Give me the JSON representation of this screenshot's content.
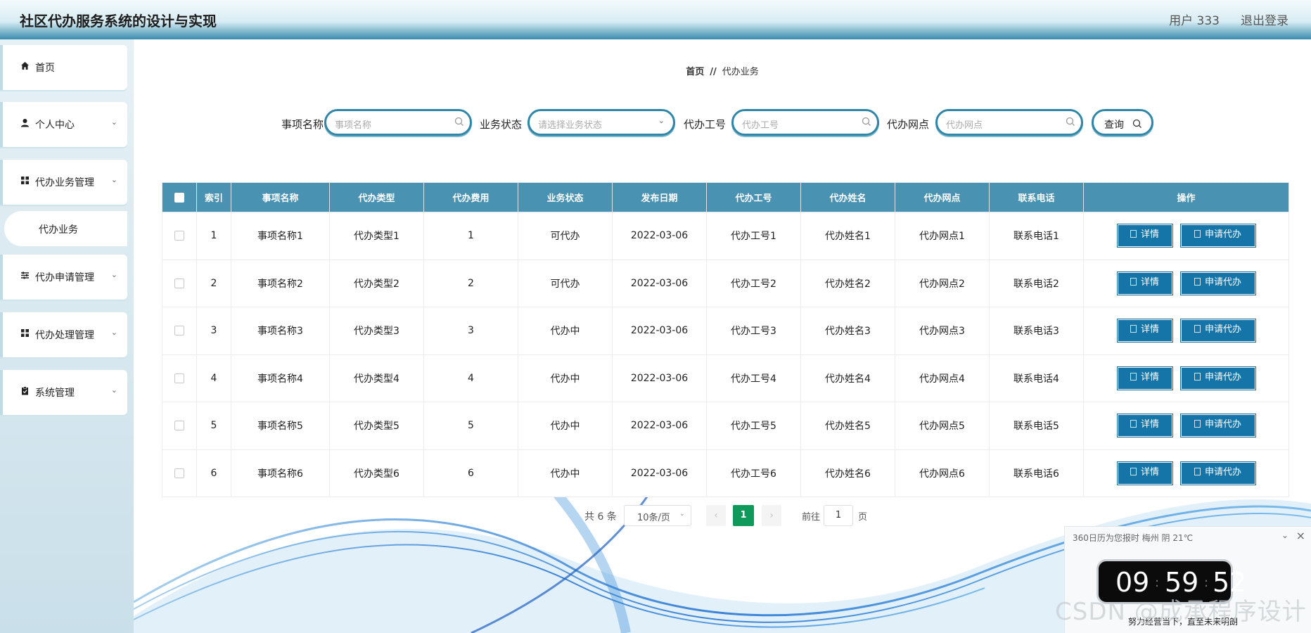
{
  "header": {
    "title": "社区代办服务系统的设计与实现",
    "user": "用户 333",
    "logout": "退出登录"
  },
  "sidebar": {
    "items": [
      {
        "label": "首页",
        "icon": "home-icon"
      },
      {
        "label": "个人中心",
        "icon": "user-icon"
      },
      {
        "label": "代办业务管理",
        "icon": "grid-icon"
      },
      {
        "label": "代办申请管理",
        "icon": "sliders-icon"
      },
      {
        "label": "代办处理管理",
        "icon": "grid-icon"
      },
      {
        "label": "系统管理",
        "icon": "clipboard-icon"
      }
    ],
    "sub_active": "代办业务"
  },
  "breadcrumb": {
    "home": "首页",
    "separator": "//",
    "current": "代办业务"
  },
  "search": {
    "item_name_label": "事项名称",
    "item_name_placeholder": "事项名称",
    "status_label": "业务状态",
    "status_placeholder": "请选择业务状态",
    "staff_id_label": "代办工号",
    "staff_id_placeholder": "代办工号",
    "outlet_label": "代办网点",
    "outlet_placeholder": "代办网点",
    "query_button": "查询"
  },
  "table": {
    "columns": [
      "索引",
      "事项名称",
      "代办类型",
      "代办费用",
      "业务状态",
      "发布日期",
      "代办工号",
      "代办姓名",
      "代办网点",
      "联系电话",
      "操作"
    ],
    "rows": [
      {
        "index": "1",
        "name": "事项名称1",
        "type": "代办类型1",
        "fee": "1",
        "status": "可代办",
        "date": "2022-03-06",
        "staff_id": "代办工号1",
        "staff_name": "代办姓名1",
        "outlet": "代办网点1",
        "phone": "联系电话1"
      },
      {
        "index": "2",
        "name": "事项名称2",
        "type": "代办类型2",
        "fee": "2",
        "status": "可代办",
        "date": "2022-03-06",
        "staff_id": "代办工号2",
        "staff_name": "代办姓名2",
        "outlet": "代办网点2",
        "phone": "联系电话2"
      },
      {
        "index": "3",
        "name": "事项名称3",
        "type": "代办类型3",
        "fee": "3",
        "status": "代办中",
        "date": "2022-03-06",
        "staff_id": "代办工号3",
        "staff_name": "代办姓名3",
        "outlet": "代办网点3",
        "phone": "联系电话3"
      },
      {
        "index": "4",
        "name": "事项名称4",
        "type": "代办类型4",
        "fee": "4",
        "status": "代办中",
        "date": "2022-03-06",
        "staff_id": "代办工号4",
        "staff_name": "代办姓名4",
        "outlet": "代办网点4",
        "phone": "联系电话4"
      },
      {
        "index": "5",
        "name": "事项名称5",
        "type": "代办类型5",
        "fee": "5",
        "status": "代办中",
        "date": "2022-03-06",
        "staff_id": "代办工号5",
        "staff_name": "代办姓名5",
        "outlet": "代办网点5",
        "phone": "联系电话5"
      },
      {
        "index": "6",
        "name": "事项名称6",
        "type": "代办类型6",
        "fee": "6",
        "status": "代办中",
        "date": "2022-03-06",
        "staff_id": "代办工号6",
        "staff_name": "代办姓名6",
        "outlet": "代办网点6",
        "phone": "联系电话6"
      }
    ],
    "detail_button": "详情",
    "apply_button": "申请代办"
  },
  "pagination": {
    "total": "共 6 条",
    "page_size": "10条/页",
    "current_page": "1",
    "goto_label": "前往",
    "goto_value": "1",
    "goto_unit": "页"
  },
  "widget": {
    "title": "360日历为您报时 梅州 阴 21℃",
    "hours": "09",
    "minutes": "59",
    "seconds": "52",
    "motto": "努力经营当下，直至未来明朗"
  },
  "watermark": "CSDN @成承程序设计",
  "colors": {
    "header_dark": "#3b8db0",
    "table_header": "#4a92b2",
    "action_button": "#1675a8",
    "page_active": "#0d9a5a"
  }
}
